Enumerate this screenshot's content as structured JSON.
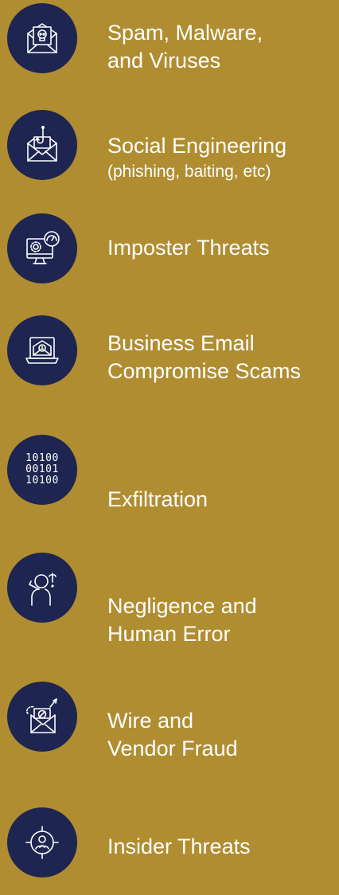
{
  "colors": {
    "background": "#b08d31",
    "icon_circle": "#1d2550",
    "text": "#ffffff"
  },
  "items": [
    {
      "icon": "email-malware-icon",
      "line1": "Spam, Malware,",
      "line2": "and Viruses"
    },
    {
      "icon": "phishing-hook-icon",
      "line1": "Social Engineering",
      "line2": "(phishing, baiting, etc)"
    },
    {
      "icon": "monitor-settings-icon",
      "line1": "Imposter Threats",
      "line2": ""
    },
    {
      "icon": "laptop-email-icon",
      "line1": "Business Email",
      "line2": "Compromise Scams"
    },
    {
      "icon": "binary-data-icon",
      "line1": "Exfiltration",
      "line2": "",
      "binary": [
        "10100",
        "00101",
        "10100"
      ]
    },
    {
      "icon": "confused-person-icon",
      "line1": "Negligence and",
      "line2": "Human Error"
    },
    {
      "icon": "email-fraud-icon",
      "line1": "Wire and",
      "line2": "Vendor Fraud"
    },
    {
      "icon": "target-person-icon",
      "line1": "Insider Threats",
      "line2": ""
    }
  ]
}
